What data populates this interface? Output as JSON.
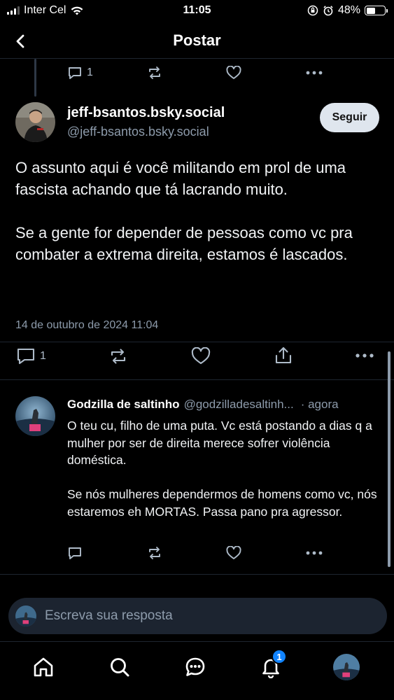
{
  "status_bar": {
    "carrier": "Inter Cel",
    "time": "11:05",
    "battery": "48%",
    "battery_level": 0.48
  },
  "header": {
    "title": "Postar"
  },
  "parent_post_actions": {
    "reply_count": "1"
  },
  "post": {
    "author_name": "jeff-bsantos.bsky.social",
    "author_handle": "@jeff-bsantos.bsky.social",
    "follow_label": "Seguir",
    "paragraphs": [
      "O assunto aqui é você militando em prol de uma fascista achando que tá lacrando muito.",
      "Se a gente for depender de pessoas como vc pra combater a extrema direita, estamos é lascados."
    ],
    "date": "14 de outubro de 2024 11:04",
    "reply_count": "1"
  },
  "reply": {
    "author_name": "Godzilla de saltinho",
    "author_handle": "@godzilladesaltinh...",
    "time": "· agora",
    "paragraphs": [
      "O teu cu, filho de uma puta. Vc está postando a dias q a mulher por ser de direita merece sofrer violência doméstica.",
      "Se nós mulheres dependermos de homens como vc, nós estaremos eh MORTAS. Passa pano pra agressor."
    ]
  },
  "composer": {
    "placeholder": "Escreva sua resposta"
  },
  "bottom_nav": {
    "notifications_badge": "1",
    "items": [
      "home-icon",
      "search-icon",
      "chat-icon",
      "bell-icon",
      "profile-avatar"
    ]
  },
  "colors": {
    "background": "#000000",
    "accent": "#1083fe",
    "muted_text": "#8d9bab",
    "icon": "#aebbc9",
    "follow_button": "#dfe6ee"
  }
}
